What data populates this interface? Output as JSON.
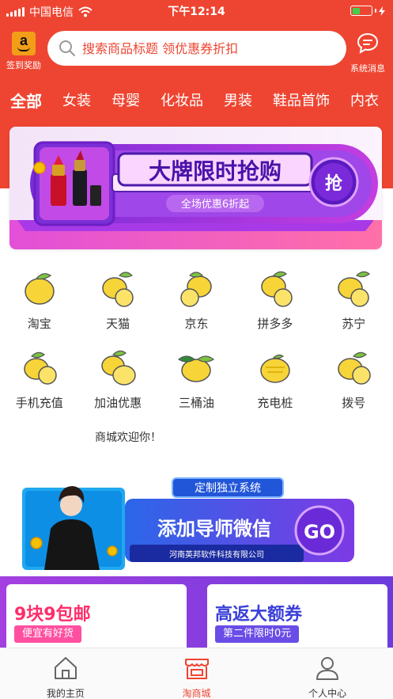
{
  "status_bar": {
    "carrier": "中国电信",
    "time": "下午12:14"
  },
  "header": {
    "signin_label": "签到奖励",
    "search_placeholder": "搜索商品标题 领优惠券折扣",
    "message_label": "系统消息"
  },
  "tabs": [
    {
      "label": "全部",
      "active": true
    },
    {
      "label": "女装"
    },
    {
      "label": "母婴"
    },
    {
      "label": "化妆品"
    },
    {
      "label": "男装"
    },
    {
      "label": "鞋品首饰"
    },
    {
      "label": "内衣"
    }
  ],
  "banner": {
    "title": "大牌限时抢购",
    "subtitle": "全场优惠6折起",
    "button": "抢"
  },
  "grid": [
    {
      "label": "淘宝"
    },
    {
      "label": "天猫"
    },
    {
      "label": "京东"
    },
    {
      "label": "拼多多"
    },
    {
      "label": "苏宁"
    },
    {
      "label": "手机充值"
    },
    {
      "label": "加油优惠"
    },
    {
      "label": "三桶油"
    },
    {
      "label": "充电桩"
    },
    {
      "label": "拨号"
    }
  ],
  "welcome": "商城欢迎你！",
  "promo": {
    "tag": "定制独立系统",
    "title": "添加导师微信",
    "button": "GO",
    "company": "河南英邦软件科技有限公司"
  },
  "cards": [
    {
      "title": "9块9包邮",
      "subtitle": "便宜有好货",
      "title_color": "#ff2d6a",
      "sub_color": "#ff4fa0"
    },
    {
      "title": "高返大额券",
      "subtitle": "第二件限时0元",
      "title_color": "#3a3fd8",
      "sub_color": "#6a4de6"
    }
  ],
  "tabbar": [
    {
      "label": "我的主页"
    },
    {
      "label": "淘商城",
      "active": true
    },
    {
      "label": "个人中心"
    }
  ],
  "colors": {
    "brand": "#ee4532",
    "lemon": "#f7d437"
  }
}
